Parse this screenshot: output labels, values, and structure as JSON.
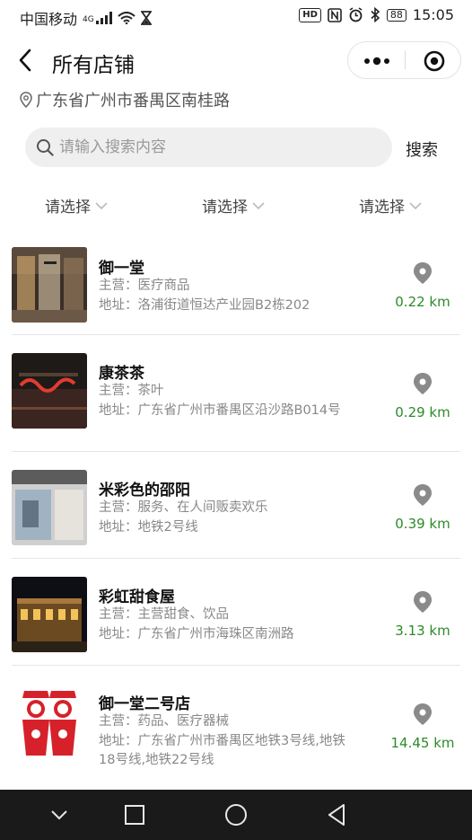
{
  "status_bar": {
    "carrier": "中国移动",
    "signal_label": "4G",
    "hd_label": "HD",
    "battery": "88",
    "time": "15:05"
  },
  "nav": {
    "title": "所有店铺"
  },
  "location": {
    "text": "广东省广州市番禺区南桂路"
  },
  "search": {
    "placeholder": "请输入搜索内容",
    "button_label": "搜索"
  },
  "filters": [
    {
      "label": "请选择"
    },
    {
      "label": "请选择"
    },
    {
      "label": "请选择"
    }
  ],
  "colors": {
    "distance_green": "#2c8a27",
    "pin_gray": "#8a8a8a"
  },
  "stores": [
    {
      "name": "御一堂",
      "business": "主营：医疗商品",
      "address": "地址：洛浦街道恒达产业园B2栋202",
      "distance": "0.22 km",
      "thumb": "mall-storefront"
    },
    {
      "name": "康茶茶",
      "business": "主营：茶叶",
      "address": "地址：广东省广州市番禺区沿沙路B014号",
      "distance": "0.29 km",
      "thumb": "neon-restaurant"
    },
    {
      "name": "米彩色的邵阳",
      "business": "主营：服务、在人间贩卖欢乐",
      "address": "地址：地铁2号线",
      "distance": "0.39 km",
      "thumb": "shop-window"
    },
    {
      "name": "彩虹甜食屋",
      "business": "主营：主营甜食、饮品",
      "address": "地址：广东省广州市海珠区南洲路",
      "distance": "3.13 km",
      "thumb": "night-building"
    },
    {
      "name": "御一堂二号店",
      "business": "主营：药品、医疗器械",
      "address": "地址：广东省广州市番禺区地铁3号线,地铁18号线,地铁22号线",
      "distance": "14.45 km",
      "thumb": "papercut-couple"
    }
  ]
}
